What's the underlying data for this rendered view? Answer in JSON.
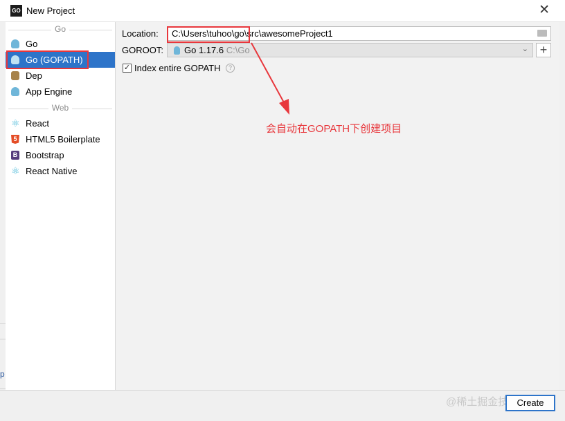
{
  "window": {
    "app_icon_text": "GO",
    "title": "New Project",
    "close_glyph": "✕"
  },
  "sidebar": {
    "groups": [
      {
        "header": "Go",
        "items": [
          {
            "label": "Go",
            "icon": "gopher-icon"
          },
          {
            "label": "Go (GOPATH)",
            "icon": "gopher-icon",
            "selected": true
          },
          {
            "label": "Dep",
            "icon": "dep-icon"
          },
          {
            "label": "App Engine",
            "icon": "app-engine-icon"
          }
        ]
      },
      {
        "header": "Web",
        "items": [
          {
            "label": "React",
            "icon": "react-icon"
          },
          {
            "label": "HTML5 Boilerplate",
            "icon": "html5-icon"
          },
          {
            "label": "Bootstrap",
            "icon": "bootstrap-icon"
          },
          {
            "label": "React Native",
            "icon": "react-icon"
          }
        ]
      }
    ]
  },
  "form": {
    "location": {
      "label": "Location:",
      "value": "C:\\Users\\tuhoo\\go\\src\\awesomeProject1"
    },
    "goroot": {
      "label": "GOROOT:",
      "version": "Go 1.17.6",
      "path": "C:\\Go"
    },
    "add_sdk_glyph": "+",
    "index_gopath": {
      "label": "Index entire GOPATH",
      "checked": true,
      "check_glyph": "✓",
      "help_glyph": "?"
    }
  },
  "annotation": {
    "text": "会自动在GOPATH下创建项目",
    "color": "#e8373c"
  },
  "footer": {
    "create_label": "Create"
  },
  "watermark": "@稀土掘金技术社区",
  "edge_fragment": "p",
  "colors": {
    "selection": "#2d74c9",
    "highlight": "#e8373c"
  }
}
